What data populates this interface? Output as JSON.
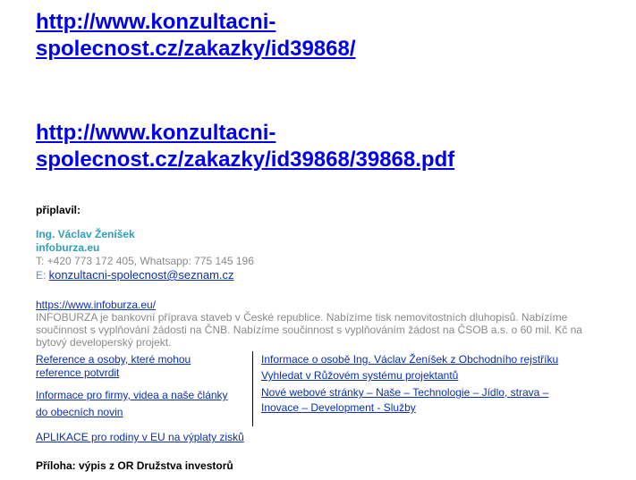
{
  "links": {
    "main_url_line1": "http://www.konzultacni-",
    "main_url_line2": "spolecnost.cz/zakazky/id39868/",
    "pdf_url_line1": "http://www.konzultacni-",
    "pdf_url_line2": "spolecnost.cz/zakazky/id39868/39868.pdf"
  },
  "prepared_label": "připlavil:",
  "author": {
    "name": "Ing. Václav Ženíšek",
    "site": "infoburza.eu",
    "phone": "T: +420 773 172 405, Whatsapp: 775 145 196",
    "email_prefix": "E: ",
    "email": "konzultacni-spolecnost@seznam.cz"
  },
  "info": {
    "url": "https://www.infoburza.eu/",
    "text": "INFOBURZA je bankovní příprava staveb v České republice. Nabízíme tisk nemovitostních dluhopisů. Nabízíme součinnost s vyplňování žádosti na ČNB. Nabízíme součinnost s vyplňováním žádost na ČSOB a.s. o 60 mil. Kč na bytový developerský projekt."
  },
  "left_links": {
    "references": "Reference a osoby, které mohou reference potvrdit",
    "firms": "Informace pro firmy, videa a naše články do obecních novin"
  },
  "right_links": {
    "about": "Informace o osobě Ing. Václav Ženíšek z Obchodního rejstříku",
    "search": "Vyhledat v Růžovém systému projektantů",
    "new_site": "Nové webové stránky – Naše – Technologie – Jídlo, strava – Inovace – Development - Služby"
  },
  "app_link": "APLIKACE pro rodiny v EU na výplaty zisků",
  "attachment": "Příloha: výpis z OR Družstva investorů"
}
